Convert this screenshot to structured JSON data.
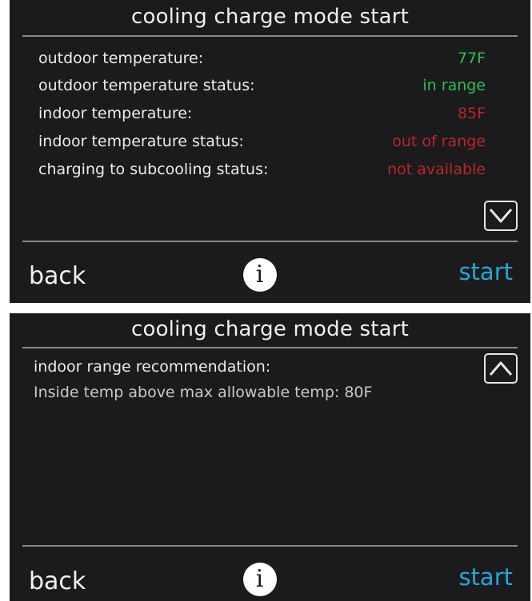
{
  "screen1": {
    "title": "cooling charge mode start",
    "rows": [
      {
        "label": "outdoor temperature:",
        "value": "77F",
        "status": "ok"
      },
      {
        "label": "outdoor temperature status:",
        "value": "in range",
        "status": "ok"
      },
      {
        "label": "indoor temperature:",
        "value": "85F",
        "status": "alert"
      },
      {
        "label": "indoor temperature status:",
        "value": "out of range",
        "status": "alert"
      },
      {
        "label": "charging to subcooling status:",
        "value": "not available",
        "status": "alert"
      }
    ],
    "scroll_icon": "chevron-down-icon",
    "back_label": "back",
    "info_label": "i",
    "start_label": "start"
  },
  "screen2": {
    "title": "cooling charge mode start",
    "recommendation_label": "indoor range recommendation:",
    "recommendation_text": "Inside temp above max allowable temp: 80F",
    "scroll_icon": "chevron-up-icon",
    "back_label": "back",
    "info_label": "i",
    "start_label": "start"
  },
  "colors": {
    "background": "#1b1b1d",
    "ok": "#2fbe4f",
    "alert": "#b8262a",
    "accent": "#27a6d6"
  }
}
